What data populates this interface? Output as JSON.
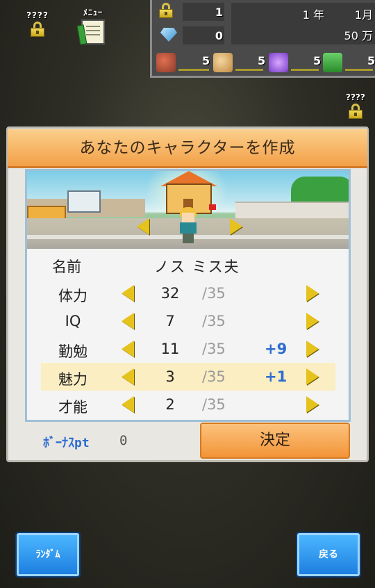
{
  "top_icons": {
    "locked_label": "????",
    "menu_label": "ﾒﾆｭｰ"
  },
  "status": {
    "locked_count": "1",
    "gems": "0",
    "year": "1 年",
    "month": "1月",
    "money": "50 万",
    "resources": [
      {
        "icon": "food-icon",
        "value": "5"
      },
      {
        "icon": "bread-icon",
        "value": "5"
      },
      {
        "icon": "music-note-icon",
        "value": "5"
      },
      {
        "icon": "book-icon",
        "value": "5"
      }
    ]
  },
  "side_lock": {
    "label": "????"
  },
  "dialog": {
    "title": "あなたのキャラクターを作成",
    "name_label": "名前",
    "name_value": "ノス ミス夫",
    "stats": [
      {
        "label": "体力",
        "value": "32",
        "max": "/35",
        "bonus": ""
      },
      {
        "label": "IQ",
        "value": "7",
        "max": "/35",
        "bonus": ""
      },
      {
        "label": "勤勉",
        "value": "11",
        "max": "/35",
        "bonus": "+9"
      },
      {
        "label": "魅力",
        "value": "3",
        "max": "/35",
        "bonus": "+1"
      },
      {
        "label": "才能",
        "value": "2",
        "max": "/35",
        "bonus": ""
      }
    ],
    "bonus_pt_label": "ﾎﾞｰﾅｽpt",
    "bonus_pt_value": "0",
    "confirm_label": "決定"
  },
  "buttons": {
    "random_label": "ﾗﾝﾀﾞﾑ",
    "back_label": "戻る"
  },
  "colors": {
    "accent_orange": "#f39438",
    "bonus_blue": "#2e6cd0",
    "arrow_yellow": "#e6c21c",
    "button_blue": "#1d7fe0"
  }
}
